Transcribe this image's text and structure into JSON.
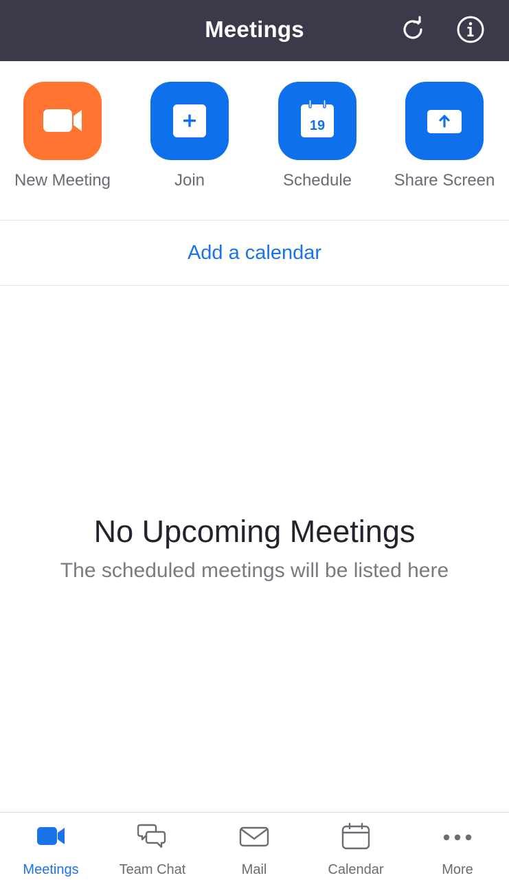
{
  "header": {
    "title": "Meetings",
    "refresh_icon": "refresh-icon",
    "info_icon": "info-icon"
  },
  "actions": [
    {
      "label": "New Meeting",
      "icon": "video-camera-icon",
      "color": "#ff742e"
    },
    {
      "label": "Join",
      "icon": "plus-icon",
      "color": "#0e71eb"
    },
    {
      "label": "Schedule",
      "icon": "calendar-icon",
      "day": "19",
      "color": "#0e71eb"
    },
    {
      "label": "Share Screen",
      "icon": "share-up-arrow-icon",
      "color": "#0e71eb"
    }
  ],
  "calendar_link": "Add a calendar",
  "empty_state": {
    "title": "No Upcoming Meetings",
    "subtitle": "The scheduled meetings will be listed here"
  },
  "tabs": [
    {
      "label": "Meetings",
      "icon": "video-camera-icon",
      "active": true
    },
    {
      "label": "Team Chat",
      "icon": "chat-bubbles-icon",
      "active": false
    },
    {
      "label": "Mail",
      "icon": "mail-icon",
      "active": false
    },
    {
      "label": "Calendar",
      "icon": "calendar-icon",
      "active": false
    },
    {
      "label": "More",
      "icon": "more-dots-icon",
      "active": false
    }
  ],
  "colors": {
    "header_bg": "#3a3a4b",
    "accent": "#1a73e8",
    "orange": "#ff742e"
  }
}
